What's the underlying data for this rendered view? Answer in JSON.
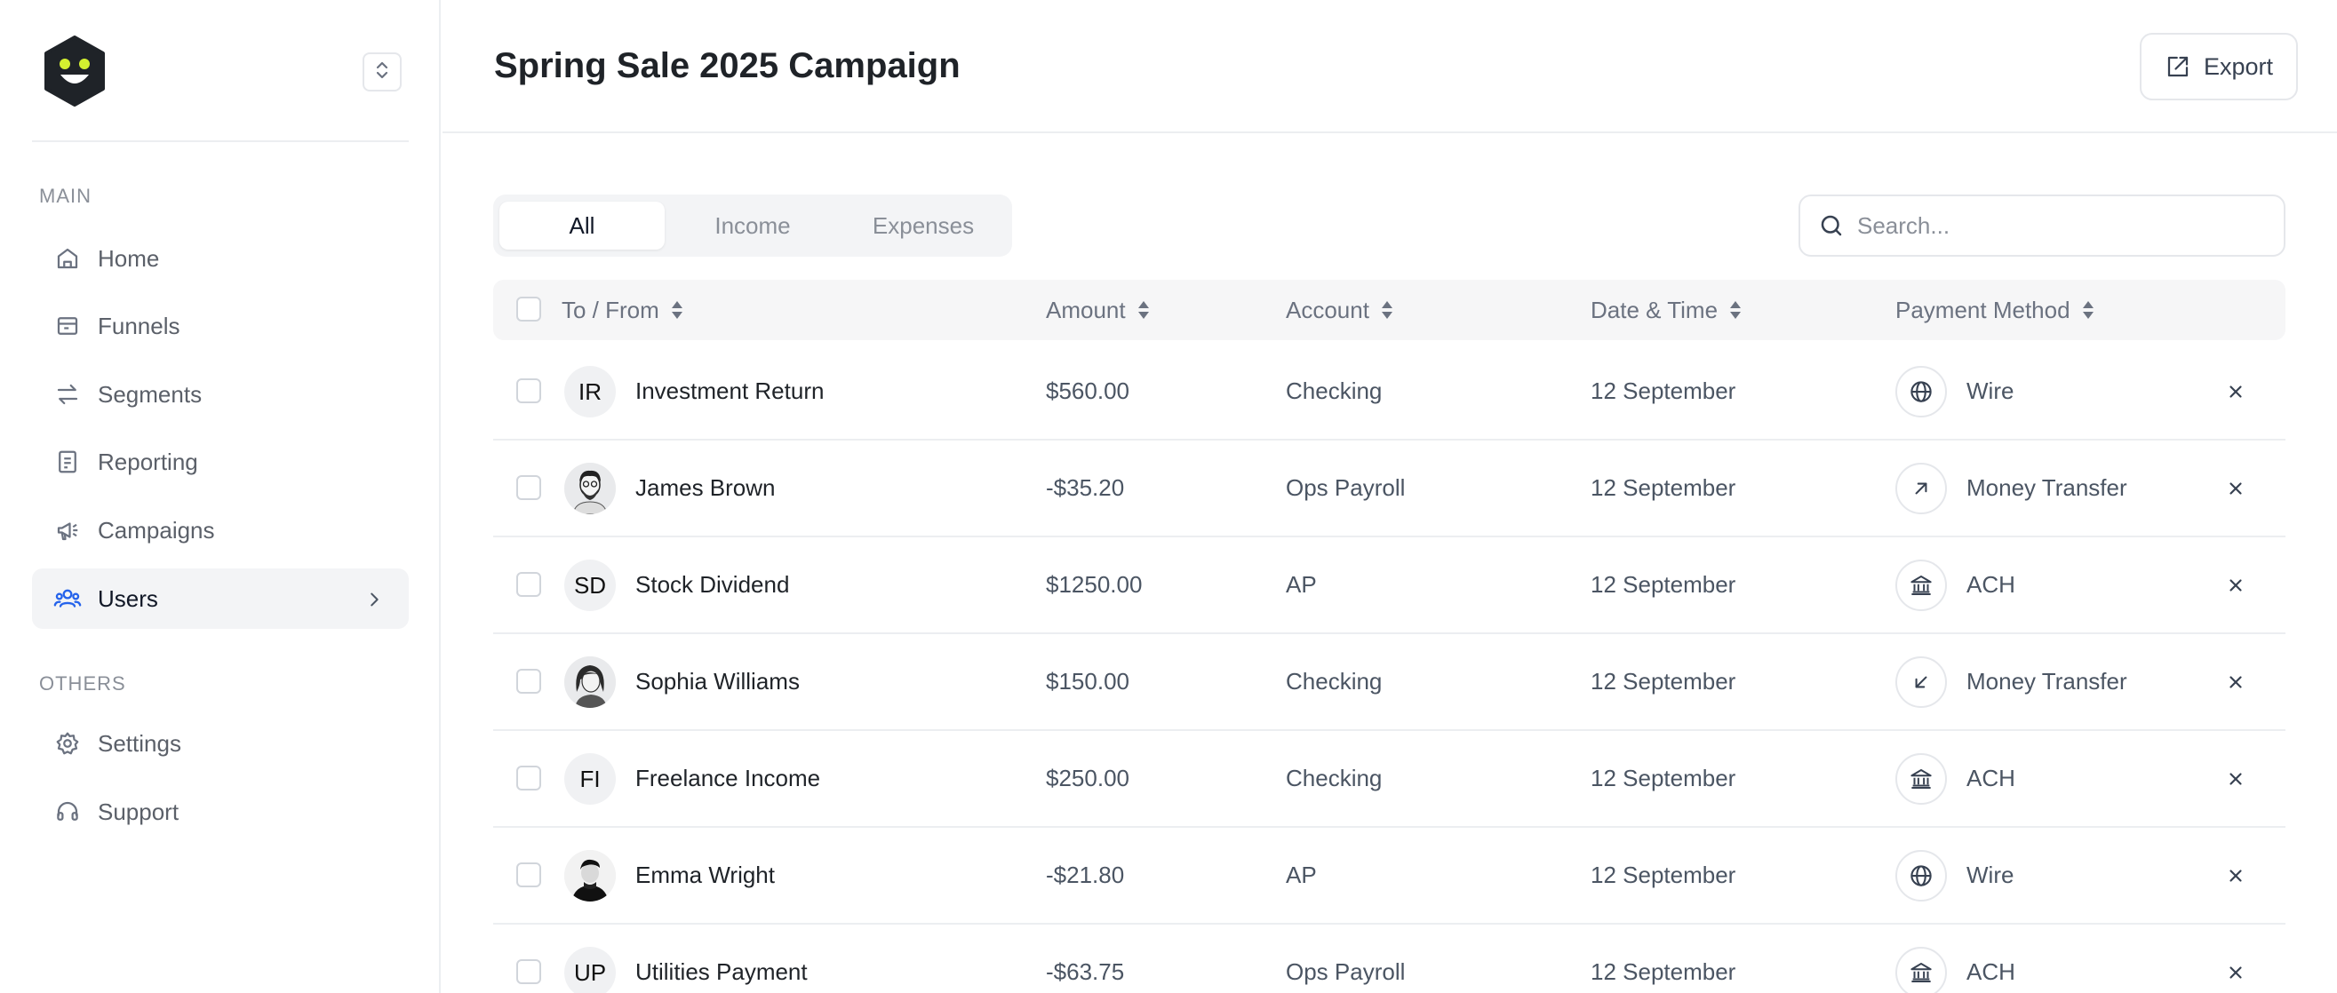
{
  "sidebar": {
    "sections": [
      {
        "label": "MAIN"
      },
      {
        "label": "OTHERS"
      }
    ],
    "items": [
      {
        "label": "Home",
        "icon": "home-icon"
      },
      {
        "label": "Funnels",
        "icon": "funnel-icon"
      },
      {
        "label": "Segments",
        "icon": "segments-icon"
      },
      {
        "label": "Reporting",
        "icon": "report-icon"
      },
      {
        "label": "Campaigns",
        "icon": "megaphone-icon"
      },
      {
        "label": "Users",
        "icon": "users-icon",
        "active": true
      },
      {
        "label": "Settings",
        "icon": "gear-icon"
      },
      {
        "label": "Support",
        "icon": "headset-icon"
      }
    ]
  },
  "header": {
    "title": "Spring Sale 2025 Campaign",
    "export_label": "Export"
  },
  "filters": {
    "tabs": [
      {
        "label": "All",
        "active": true
      },
      {
        "label": "Income"
      },
      {
        "label": "Expenses"
      }
    ]
  },
  "search": {
    "placeholder": "Search..."
  },
  "table": {
    "columns": [
      "To / From",
      "Amount",
      "Account",
      "Date & Time",
      "Payment Method"
    ],
    "rows": [
      {
        "initials": "IR",
        "name": "Investment Return",
        "amount": "$560.00",
        "account": "Checking",
        "date": "12 September",
        "method": "Wire",
        "method_icon": "globe-icon"
      },
      {
        "initials": "",
        "name": "James Brown",
        "amount": "-$35.20",
        "account": "Ops Payroll",
        "date": "12 September",
        "method": "Money Transfer",
        "method_icon": "arrow-up-right-icon"
      },
      {
        "initials": "SD",
        "name": "Stock Dividend",
        "amount": "$1250.00",
        "account": "AP",
        "date": "12 September",
        "method": "ACH",
        "method_icon": "bank-icon"
      },
      {
        "initials": "",
        "name": "Sophia Williams",
        "amount": "$150.00",
        "account": "Checking",
        "date": "12 September",
        "method": "Money Transfer",
        "method_icon": "arrow-down-left-icon"
      },
      {
        "initials": "FI",
        "name": "Freelance Income",
        "amount": "$250.00",
        "account": "Checking",
        "date": "12 September",
        "method": "ACH",
        "method_icon": "bank-icon"
      },
      {
        "initials": "",
        "name": "Emma Wright",
        "amount": "-$21.80",
        "account": "AP",
        "date": "12 September",
        "method": "Wire",
        "method_icon": "globe-icon"
      },
      {
        "initials": "UP",
        "name": "Utilities Payment",
        "amount": "-$63.75",
        "account": "Ops Payroll",
        "date": "12 September",
        "method": "ACH",
        "method_icon": "bank-icon"
      }
    ]
  },
  "colors": {
    "accent": "#2563eb",
    "logo_body": "#1f2328",
    "logo_eyes": "#d4f030"
  }
}
